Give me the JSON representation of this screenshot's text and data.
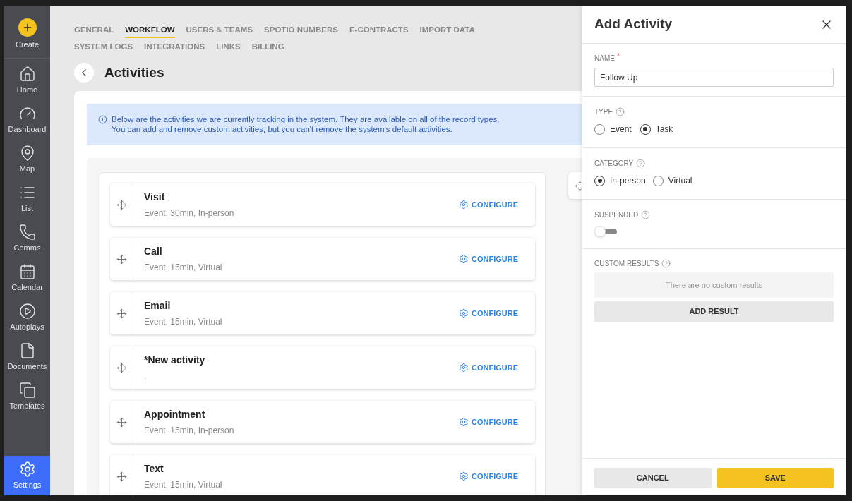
{
  "sidebar": {
    "create": {
      "label": "Create"
    },
    "items": [
      {
        "kind": "home",
        "label": "Home",
        "selected": false
      },
      {
        "kind": "dashboard",
        "label": "Dashboard",
        "selected": false
      },
      {
        "kind": "map",
        "label": "Map",
        "selected": false
      },
      {
        "kind": "list",
        "label": "List",
        "selected": false
      },
      {
        "kind": "comms",
        "label": "Comms",
        "selected": false
      },
      {
        "kind": "calendar",
        "label": "Calendar",
        "selected": false
      },
      {
        "kind": "autoplays",
        "label": "Autoplays",
        "selected": false
      },
      {
        "kind": "documents",
        "label": "Documents",
        "selected": false
      },
      {
        "kind": "templates",
        "label": "Templates",
        "selected": false
      }
    ],
    "bottom_items": [
      {
        "kind": "settings",
        "label": "Settings",
        "selected": true
      }
    ]
  },
  "tabs": [
    {
      "label": "GENERAL",
      "selected": false
    },
    {
      "label": "WORKFLOW",
      "selected": true
    },
    {
      "label": "USERS & TEAMS",
      "selected": false
    },
    {
      "label": "SPOTIO NUMBERS",
      "selected": false
    },
    {
      "label": "E-CONTRACTS",
      "selected": false
    },
    {
      "label": "IMPORT DATA",
      "selected": false
    },
    {
      "label": "SYSTEM LOGS",
      "selected": false
    },
    {
      "label": "INTEGRATIONS",
      "selected": false
    },
    {
      "label": "LINKS",
      "selected": false
    },
    {
      "label": "BILLING",
      "selected": false
    }
  ],
  "page": {
    "title": "Activities",
    "info": [
      "Below are the activities we are currently tracking in the system. They are available on all of the record types.",
      "You can add and remove custom activities, but you can't remove the system's default activities."
    ]
  },
  "activities": [
    {
      "name": "Visit",
      "details": "Event, 30min, In-person",
      "action": "CONFIGURE"
    },
    {
      "name": "Call",
      "details": "Event, 15min, Virtual",
      "action": "CONFIGURE"
    },
    {
      "name": "Email",
      "details": "Event, 15min, Virtual",
      "action": "CONFIGURE"
    },
    {
      "name": "*New activity",
      "details": ",",
      "action": "CONFIGURE"
    },
    {
      "name": "Appointment",
      "details": "Event, 15min, In-person",
      "action": "CONFIGURE"
    },
    {
      "name": "Text",
      "details": "Event, 15min, Virtual",
      "action": "CONFIGURE"
    }
  ],
  "panel": {
    "title": "Add Activity",
    "name_field": {
      "label": "NAME",
      "required_mark": "*",
      "value": "Follow Up"
    },
    "type": {
      "label": "TYPE",
      "options": [
        {
          "label": "Event",
          "selected": false
        },
        {
          "label": "Task",
          "selected": true
        }
      ]
    },
    "category": {
      "label": "CATEGORY",
      "options": [
        {
          "label": "In-person",
          "selected": true
        },
        {
          "label": "Virtual",
          "selected": false
        }
      ]
    },
    "suspended": {
      "label": "SUSPENDED",
      "on": false
    },
    "custom_results": {
      "label": "CUSTOM RESULTS",
      "empty_text": "There are no custom results",
      "button": "ADD RESULT"
    },
    "buttons": {
      "cancel": "CANCEL",
      "save": "SAVE"
    }
  }
}
